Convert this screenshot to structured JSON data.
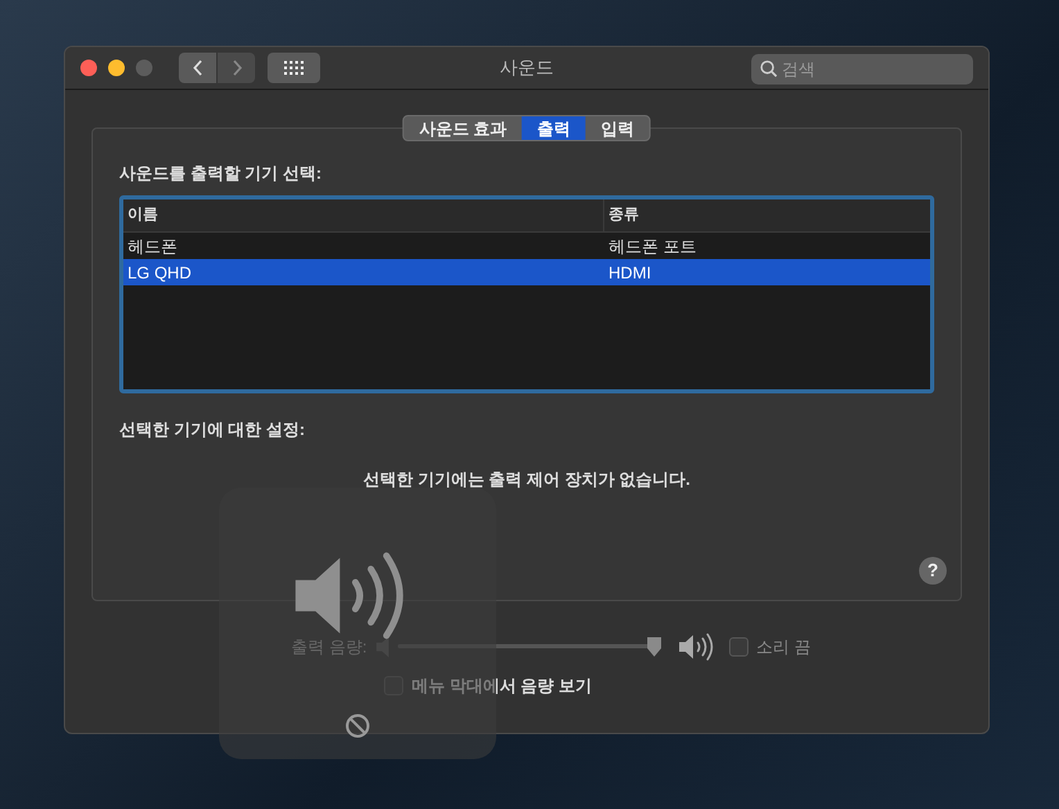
{
  "window": {
    "title": "사운드"
  },
  "search": {
    "placeholder": "검색"
  },
  "tabs": [
    {
      "label": "사운드 효과",
      "selected": false
    },
    {
      "label": "출력",
      "selected": true
    },
    {
      "label": "입력",
      "selected": false
    }
  ],
  "device_list": {
    "heading": "사운드를 출력할 기기 선택:",
    "columns": [
      "이름",
      "종류"
    ],
    "rows": [
      {
        "name": "헤드폰",
        "type": "헤드폰 포트",
        "selected": false
      },
      {
        "name": "LG QHD",
        "type": "HDMI",
        "selected": true
      }
    ]
  },
  "settings": {
    "heading": "선택한 기기에 대한 설정:",
    "message": "선택한 기기에는 출력 제어 장치가 없습니다.",
    "help": "?"
  },
  "volume": {
    "label": "출력 음량:",
    "level": 1,
    "disabled": true,
    "mute": {
      "label": "소리 끔",
      "checked": false
    }
  },
  "menu_bar_option": {
    "label": "메뉴 막대에서 음량 보기",
    "checked": false
  }
}
